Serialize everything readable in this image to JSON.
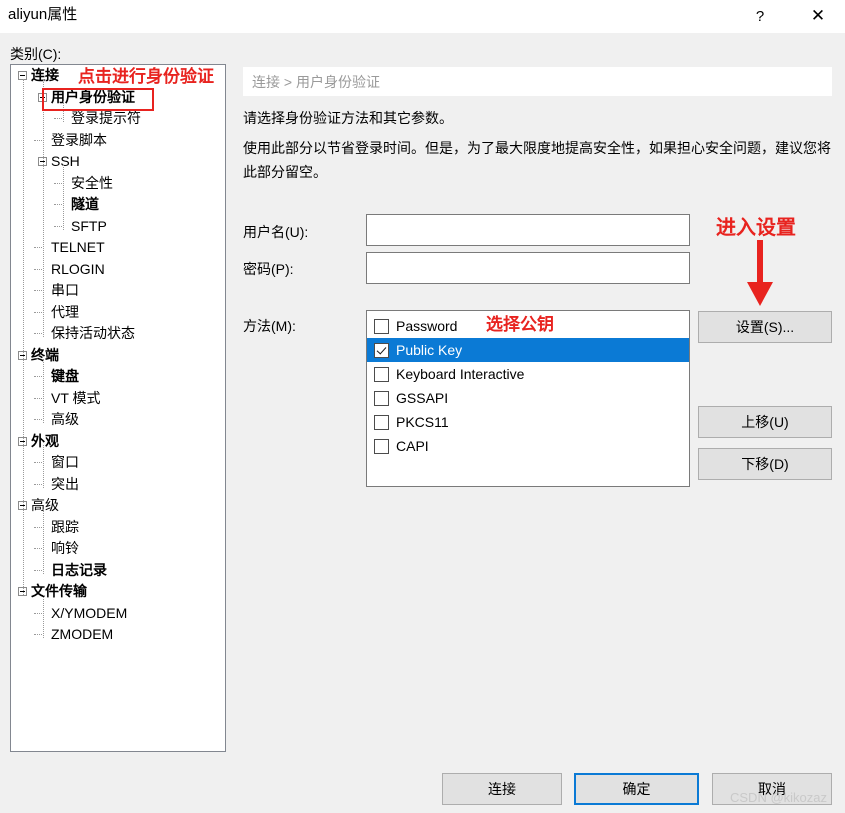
{
  "window": {
    "title": "aliyun属性",
    "help_label": "?",
    "close_label": "✕"
  },
  "sidebar": {
    "label": "类别(C):",
    "items": [
      {
        "label": "连接",
        "level": 0,
        "bold": true,
        "toggle": true
      },
      {
        "label": "用户身份验证",
        "level": 1,
        "bold": true,
        "toggle": true
      },
      {
        "label": "登录提示符",
        "level": 2,
        "bold": false,
        "toggle": false
      },
      {
        "label": "登录脚本",
        "level": 1,
        "bold": false,
        "toggle": false
      },
      {
        "label": "SSH",
        "level": 1,
        "bold": false,
        "toggle": true
      },
      {
        "label": "安全性",
        "level": 2,
        "bold": false,
        "toggle": false
      },
      {
        "label": "隧道",
        "level": 2,
        "bold": true,
        "toggle": false
      },
      {
        "label": "SFTP",
        "level": 2,
        "bold": false,
        "toggle": false
      },
      {
        "label": "TELNET",
        "level": 1,
        "bold": false,
        "toggle": false
      },
      {
        "label": "RLOGIN",
        "level": 1,
        "bold": false,
        "toggle": false
      },
      {
        "label": "串口",
        "level": 1,
        "bold": false,
        "toggle": false
      },
      {
        "label": "代理",
        "level": 1,
        "bold": false,
        "toggle": false
      },
      {
        "label": "保持活动状态",
        "level": 1,
        "bold": false,
        "toggle": false
      },
      {
        "label": "终端",
        "level": 0,
        "bold": true,
        "toggle": true
      },
      {
        "label": "键盘",
        "level": 1,
        "bold": true,
        "toggle": false
      },
      {
        "label": "VT 模式",
        "level": 1,
        "bold": false,
        "toggle": false
      },
      {
        "label": "高级",
        "level": 1,
        "bold": false,
        "toggle": false
      },
      {
        "label": "外观",
        "level": 0,
        "bold": true,
        "toggle": true
      },
      {
        "label": "窗口",
        "level": 1,
        "bold": false,
        "toggle": false
      },
      {
        "label": "突出",
        "level": 1,
        "bold": false,
        "toggle": false
      },
      {
        "label": "高级",
        "level": 0,
        "bold": false,
        "toggle": true
      },
      {
        "label": "跟踪",
        "level": 1,
        "bold": false,
        "toggle": false
      },
      {
        "label": "响铃",
        "level": 1,
        "bold": false,
        "toggle": false
      },
      {
        "label": "日志记录",
        "level": 1,
        "bold": true,
        "toggle": false
      },
      {
        "label": "文件传输",
        "level": 0,
        "bold": true,
        "toggle": true
      },
      {
        "label": "X/YMODEM",
        "level": 1,
        "bold": false,
        "toggle": false
      },
      {
        "label": "ZMODEM",
        "level": 1,
        "bold": false,
        "toggle": false
      }
    ]
  },
  "main": {
    "breadcrumb": "连接 > 用户身份验证",
    "description_1": "请选择身份验证方法和其它参数。",
    "description_2": "使用此部分以节省登录时间。但是，为了最大限度地提高安全性，如果担心安全问题，建议您将此部分留空。",
    "username": {
      "label": "用户名(U):",
      "value": "",
      "placeholder": ""
    },
    "password": {
      "label": "密码(P):",
      "value": "",
      "placeholder": ""
    },
    "method": {
      "label": "方法(M):",
      "items": [
        {
          "label": "Password",
          "checked": false,
          "selected": false
        },
        {
          "label": "Public Key",
          "checked": true,
          "selected": true
        },
        {
          "label": "Keyboard Interactive",
          "checked": false,
          "selected": false
        },
        {
          "label": "GSSAPI",
          "checked": false,
          "selected": false
        },
        {
          "label": "PKCS11",
          "checked": false,
          "selected": false
        },
        {
          "label": "CAPI",
          "checked": false,
          "selected": false
        }
      ]
    },
    "side_buttons": {
      "settings": "设置(S)...",
      "move_up": "上移(U)",
      "move_down": "下移(D)"
    }
  },
  "footer": {
    "connect": "连接",
    "ok": "确定",
    "cancel": "取消"
  },
  "annotations": {
    "tree_note": "点击进行身份验证",
    "pubkey_note": "选择公钥",
    "settings_note": "进入设置",
    "color": "#e8231f"
  },
  "watermark": "CSDN @kikozaz"
}
